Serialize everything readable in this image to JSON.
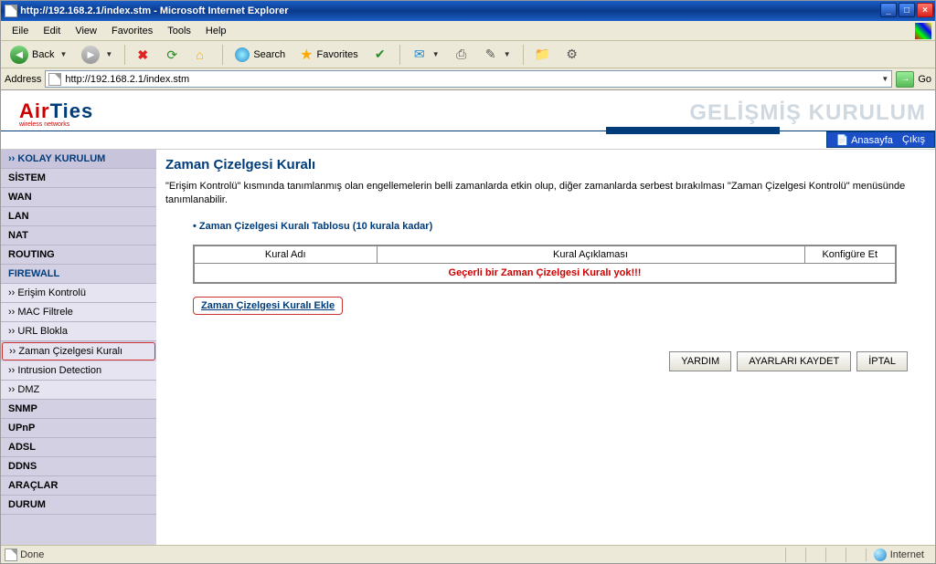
{
  "window": {
    "title": "http://192.168.2.1/index.stm - Microsoft Internet Explorer"
  },
  "menubar": [
    "Eile",
    "Edit",
    "View",
    "Favorites",
    "Tools",
    "Help"
  ],
  "toolbar": {
    "back": "Back",
    "search": "Search",
    "favorites": "Favorites"
  },
  "addressbar": {
    "label": "Address",
    "url": "http://192.168.2.1/index.stm",
    "go": "Go"
  },
  "logo": {
    "part1": "Air",
    "part2": "Ties",
    "sub": "wireless networks"
  },
  "header": {
    "title": "GELİŞMİŞ KURULUM"
  },
  "topbar": {
    "home": "Anasayfa",
    "logout": "Çıkış"
  },
  "sidebar": {
    "top": "›› KOLAY KURULUM",
    "items": [
      "SİSTEM",
      "WAN",
      "LAN",
      "NAT",
      "ROUTING",
      "FIREWALL"
    ],
    "firewall_subs": [
      "›› Erişim Kontrolü",
      "›› MAC Filtrele",
      "›› URL Blokla",
      "›› Zaman Çizelgesi Kuralı",
      "›› Intrusion Detection",
      "›› DMZ"
    ],
    "rest": [
      "SNMP",
      "UPnP",
      "ADSL",
      "DDNS",
      "ARAÇLAR",
      "DURUM"
    ]
  },
  "page": {
    "title": "Zaman Çizelgesi Kuralı",
    "desc": "\"Erişim Kontrolü\" kısmında tanımlanmış olan engellemelerin belli zamanlarda etkin olup, diğer zamanlarda serbest bırakılması \"Zaman Çizelgesi Kontrolü\" menüsünde tanımlanabilir.",
    "subtitle": "Zaman Çizelgesi Kuralı Tablosu (10 kurala kadar)",
    "table": {
      "headers": [
        "Kural Adı",
        "Kural Açıklaması",
        "Konfigüre Et"
      ],
      "empty_message": "Geçerli bir Zaman Çizelgesi Kuralı yok!!!"
    },
    "add_link": "Zaman Çizelgesi Kuralı Ekle",
    "buttons": {
      "help": "YARDIM",
      "save": "AYARLARI KAYDET",
      "cancel": "İPTAL"
    }
  },
  "status": {
    "text": "Done",
    "zone": "Internet"
  }
}
